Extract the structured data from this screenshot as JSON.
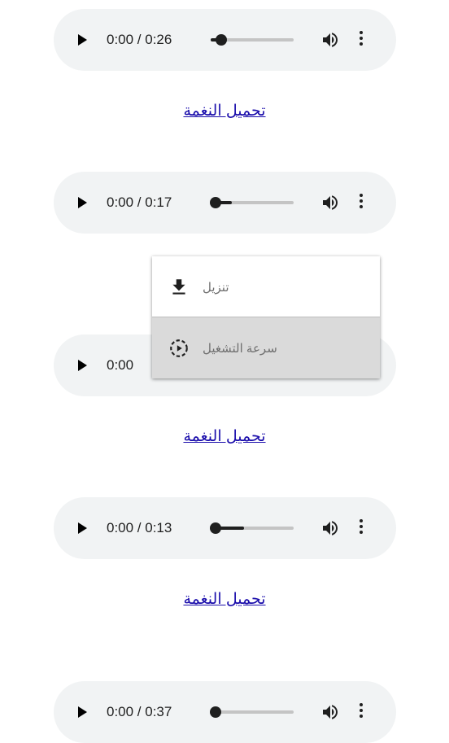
{
  "players": [
    {
      "time": "0:00 / 0:26",
      "progress_fraction": 0.12
    },
    {
      "time": "0:00 / 0:17",
      "progress_fraction": 0.25
    },
    {
      "time": "0:00",
      "progress_fraction": 0.0
    },
    {
      "time": "0:00 / 0:13",
      "progress_fraction": 0.4
    },
    {
      "time": "0:00 / 0:37",
      "progress_fraction": 0.0
    }
  ],
  "download_link_label": "تحميل النغمة",
  "menu": {
    "items": [
      {
        "label": "تنزيل",
        "icon": "download-icon"
      },
      {
        "label": "سرعة التشغيل",
        "icon": "playback-speed-icon",
        "selected": true
      }
    ]
  },
  "colors": {
    "player_bg": "#f1f3f4",
    "link": "#1a0dab",
    "menu_selected_bg": "#dadada"
  }
}
